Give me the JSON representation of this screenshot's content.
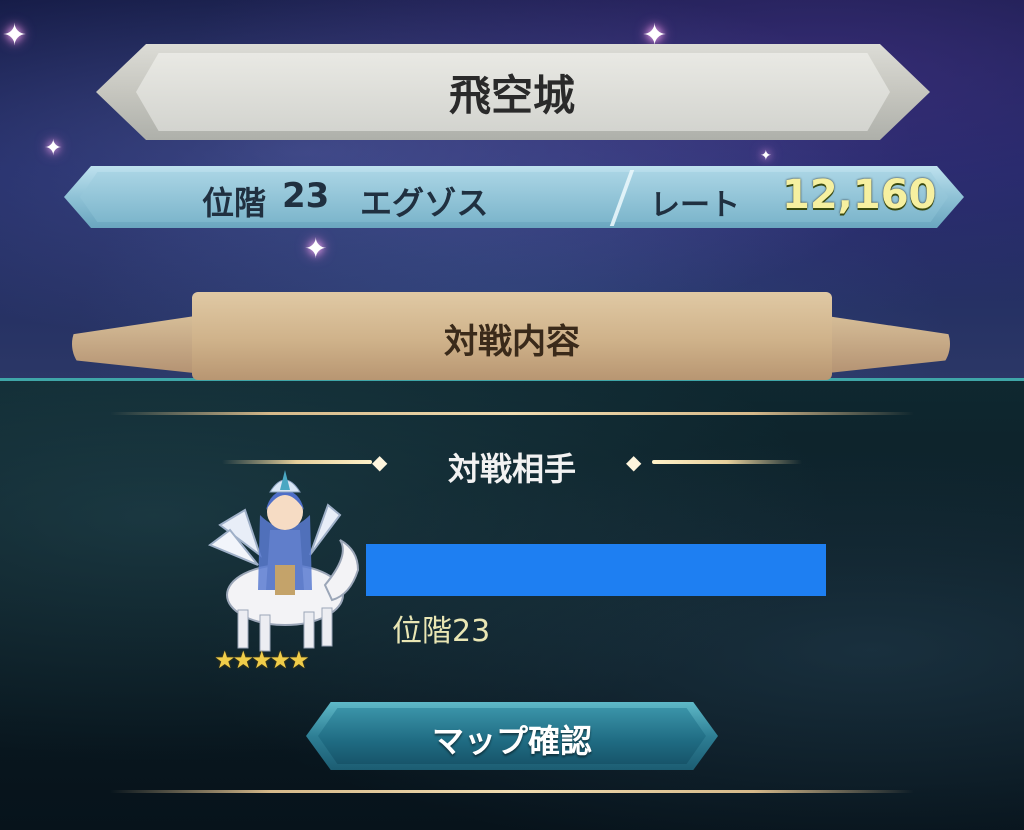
{
  "header": {
    "title": "飛空城"
  },
  "player_info": {
    "rank_label": "位階",
    "rank_value": "23",
    "league": "エグゾス",
    "rate_label": "レート",
    "rate_value": "12,160"
  },
  "battle": {
    "section_title": "対戦内容",
    "opponent_heading": "対戦相手",
    "opponent": {
      "name_redacted": true,
      "rank": "位階23",
      "stars": 5,
      "stars_glyphs": "★★★★★",
      "portrait_icon": "pegasus-knight-icon"
    }
  },
  "actions": {
    "map_check_label": "マップ確認"
  },
  "colors": {
    "rate_value": "#f6f0a0",
    "redaction": "#1e7ff2",
    "button_accent": "#2e7f95"
  }
}
